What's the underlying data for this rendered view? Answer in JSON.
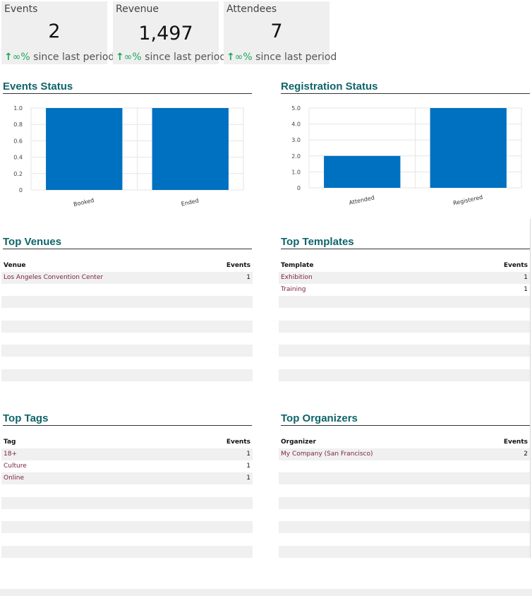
{
  "kpis": [
    {
      "label": "Events",
      "value": "2",
      "trend_arrow": "↑",
      "trend_pct": "∞%",
      "trend_text": " since last period"
    },
    {
      "label": "Revenue",
      "value": "1,497",
      "trend_arrow": "↑",
      "trend_pct": "∞%",
      "trend_text": " since last period"
    },
    {
      "label": "Attendees",
      "value": "7",
      "trend_arrow": "↑",
      "trend_pct": "∞%",
      "trend_text": " since last period"
    }
  ],
  "sections": {
    "events_status": "Events Status",
    "registration_status": "Registration Status",
    "top_venues": "Top Venues",
    "top_templates": "Top Templates",
    "top_tags": "Top Tags",
    "top_organizers": "Top Organizers"
  },
  "chart_data": [
    {
      "type": "bar",
      "categories": [
        "Booked",
        "Ended"
      ],
      "values": [
        1,
        1
      ],
      "ylim": [
        0,
        1
      ],
      "ytick_labels": [
        "0",
        "0.2",
        "0.4",
        "0.6",
        "0.8",
        "1.0"
      ],
      "ytick_values": [
        0,
        0.2,
        0.4,
        0.6,
        0.8,
        1.0
      ],
      "color": "#0070c0",
      "grid": true
    },
    {
      "type": "bar",
      "categories": [
        "Attended",
        "Registered"
      ],
      "values": [
        2,
        5
      ],
      "ylim": [
        0,
        5
      ],
      "ytick_labels": [
        "0",
        "1.0",
        "2.0",
        "3.0",
        "4.0",
        "5.0"
      ],
      "ytick_values": [
        0,
        1,
        2,
        3,
        4,
        5
      ],
      "color": "#0070c0",
      "grid": true
    }
  ],
  "tables": {
    "venues": {
      "col1": "Venue",
      "col2": "Events",
      "rows": [
        [
          "Los Angeles Convention Center",
          "1"
        ]
      ]
    },
    "templates": {
      "col1": "Template",
      "col2": "Events",
      "rows": [
        [
          "Exhibition",
          "1"
        ],
        [
          "Training",
          "1"
        ]
      ]
    },
    "tags": {
      "col1": "Tag",
      "col2": "Events",
      "rows": [
        [
          "18+",
          "1"
        ],
        [
          "Culture",
          "1"
        ],
        [
          "Online",
          "1"
        ]
      ]
    },
    "organizers": {
      "col1": "Organizer",
      "col2": "Events",
      "rows": [
        [
          "My Company (San Francisco)",
          "2"
        ]
      ]
    }
  },
  "colors": {
    "accent": "#0e6469",
    "bar": "#0070c0",
    "positive": "#1fa85a",
    "link": "#7b2343",
    "panel": "#efefef"
  },
  "icons": {
    "trend": "arrow-up-icon"
  }
}
